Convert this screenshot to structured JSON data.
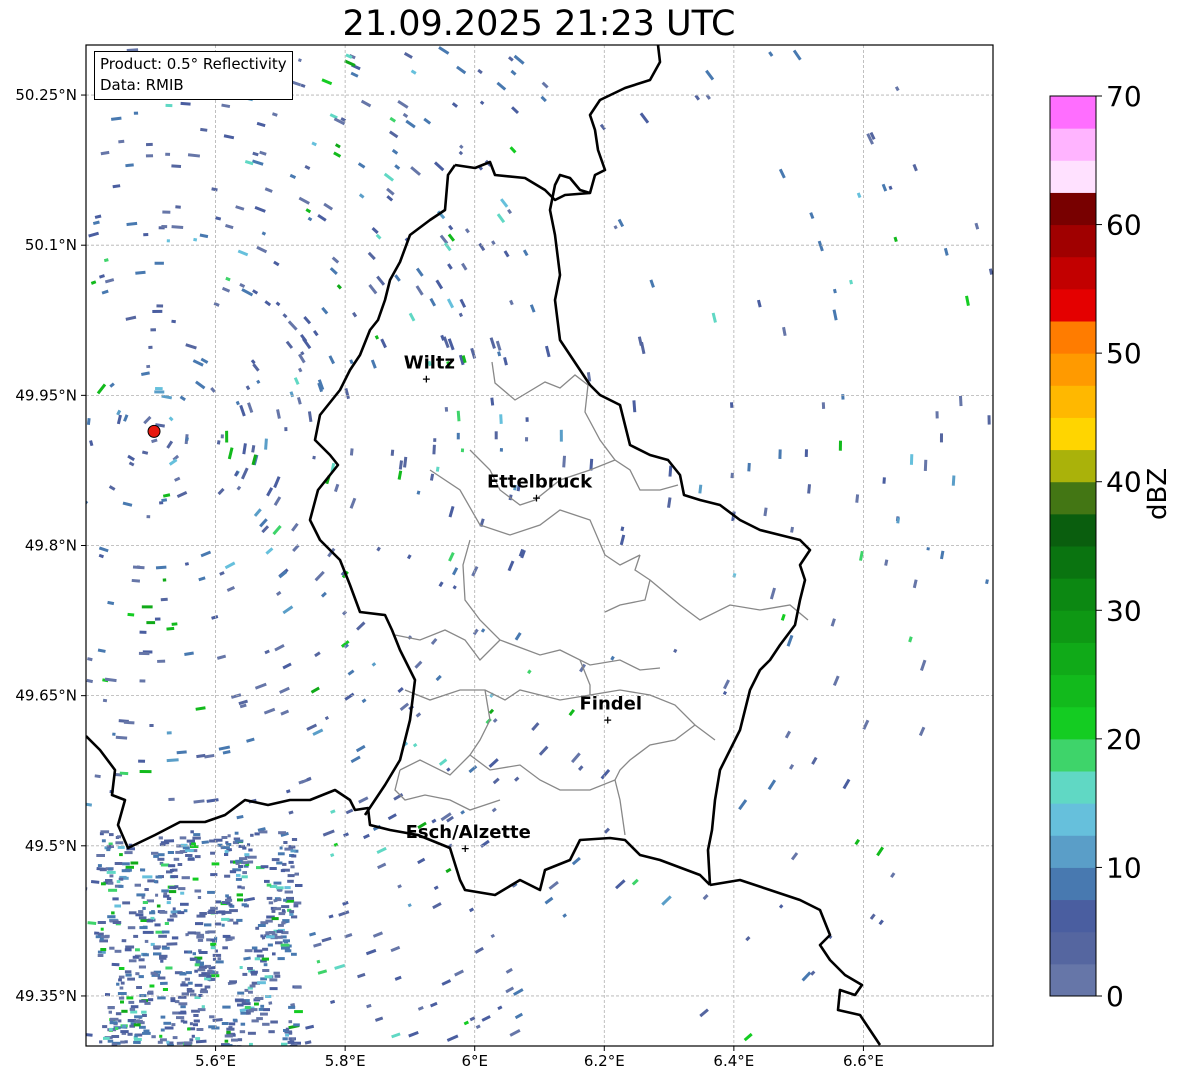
{
  "title": "21.09.2025 21:23 UTC",
  "info_box": {
    "product": "Product: 0.5° Reflectivity",
    "data_source": "Data: RMIB"
  },
  "map": {
    "lon_range": [
      5.4,
      6.8
    ],
    "lat_range": [
      49.3,
      50.3
    ],
    "lon_ticks": [
      {
        "value": 5.6,
        "label": "5.6°E"
      },
      {
        "value": 5.8,
        "label": "5.8°E"
      },
      {
        "value": 6.0,
        "label": "6°E"
      },
      {
        "value": 6.2,
        "label": "6.2°E"
      },
      {
        "value": 6.4,
        "label": "6.4°E"
      },
      {
        "value": 6.6,
        "label": "6.6°E"
      }
    ],
    "lat_ticks": [
      {
        "value": 50.25,
        "label": "50.25°N"
      },
      {
        "value": 50.1,
        "label": "50.1°N"
      },
      {
        "value": 49.95,
        "label": "49.95°N"
      },
      {
        "value": 49.8,
        "label": "49.8°N"
      },
      {
        "value": 49.65,
        "label": "49.65°N"
      },
      {
        "value": 49.5,
        "label": "49.5°N"
      },
      {
        "value": 49.35,
        "label": "49.35°N"
      }
    ],
    "cities": [
      {
        "name": "Wiltz",
        "lon": 5.93,
        "lat": 49.967
      },
      {
        "name": "Ettelbruck",
        "lon": 6.1,
        "lat": 49.848
      },
      {
        "name": "Findel",
        "lon": 6.21,
        "lat": 49.626
      },
      {
        "name": "Esch/Alzette",
        "lon": 5.99,
        "lat": 49.498
      }
    ],
    "radar_site": {
      "lon": 5.505,
      "lat": 49.914,
      "color": "#e8190f"
    },
    "grid": true,
    "colors": {
      "border": "#000000",
      "cantons": "#888888",
      "grid": "#b0b0b0"
    }
  },
  "colorbar": {
    "label": "dBZ",
    "range": [
      0,
      70
    ],
    "step": 2.5,
    "tick_values": [
      0,
      10,
      20,
      30,
      40,
      50,
      60,
      70
    ],
    "tick_labels": [
      "0",
      "10",
      "20",
      "30",
      "40",
      "50",
      "60",
      "70"
    ],
    "colors": [
      "#6676a8",
      "#5566a0",
      "#4a5ea0",
      "#4879b0",
      "#5a9ec8",
      "#66c0dc",
      "#60d8c4",
      "#3ed46a",
      "#14cc22",
      "#12ba1c",
      "#10aa18",
      "#0e9814",
      "#0c8812",
      "#0a7410",
      "#0a5e0e",
      "#437614",
      "#aab20a",
      "#ffd500",
      "#ffb800",
      "#ff9a00",
      "#ff7c00",
      "#e40000",
      "#c20000",
      "#a00000",
      "#780000",
      "#ffe1ff",
      "#ffb4ff",
      "#ff6eff",
      "#e833ee"
    ]
  }
}
